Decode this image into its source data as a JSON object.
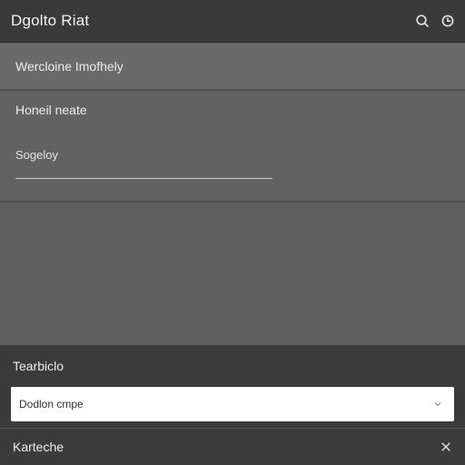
{
  "app": {
    "title": "Dgolto Riat"
  },
  "toolbar": {
    "search_icon": "search-icon",
    "settings_icon": "refresh-icon"
  },
  "main": {
    "row1_label": "Wercloine Imofhely",
    "panel_label": "Honeil neate",
    "field_label": "Sogeloy",
    "field_value": ""
  },
  "footer": {
    "section_label": "Tearbiclo",
    "select_value": "Dodlon cmpe",
    "bottom_label": "Karteche",
    "close_icon": "close-icon"
  },
  "colors": {
    "titlebar": "#3a3a3b",
    "panel": "#626262",
    "bottom": "#3b3b3c",
    "select_bg": "#ffffff"
  }
}
